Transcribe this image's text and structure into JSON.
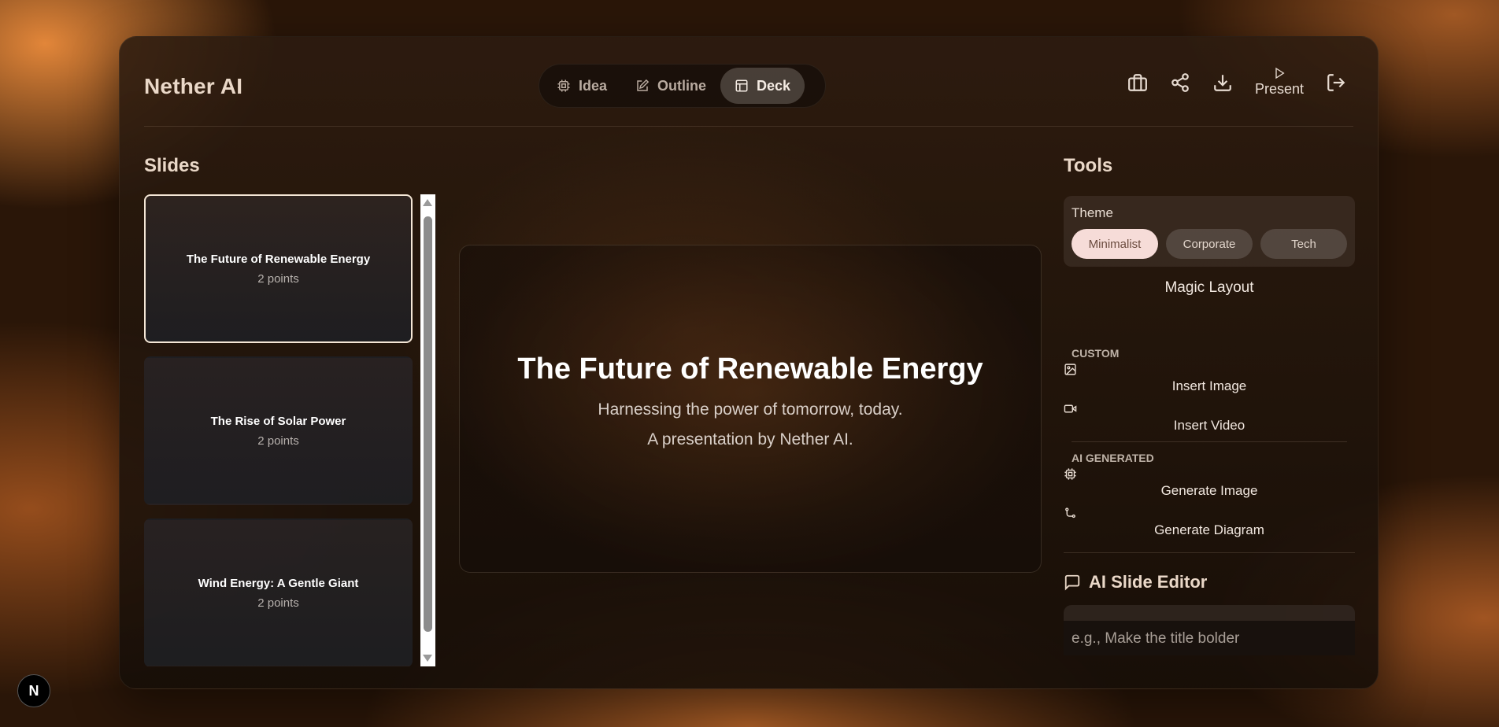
{
  "app": {
    "brand": "Nether AI"
  },
  "nav": {
    "tabs": [
      {
        "label": "Idea",
        "icon": "cpu-icon",
        "active": false
      },
      {
        "label": "Outline",
        "icon": "edit-icon",
        "active": false
      },
      {
        "label": "Deck",
        "icon": "layout-icon",
        "active": true
      }
    ]
  },
  "actions": {
    "present_label": "Present",
    "icons": [
      "briefcase-icon",
      "share-icon",
      "download-icon",
      "play-icon",
      "logout-icon"
    ]
  },
  "slides": {
    "heading": "Slides",
    "items": [
      {
        "title": "The Future of Renewable Energy",
        "subtitle": "2 points",
        "active": true
      },
      {
        "title": "The Rise of Solar Power",
        "subtitle": "2 points",
        "active": false
      },
      {
        "title": "Wind Energy: A Gentle Giant",
        "subtitle": "2 points",
        "active": false
      }
    ]
  },
  "canvas": {
    "title": "The Future of Renewable Energy",
    "subtitle": "Harnessing the power of tomorrow, today.",
    "byline": "A presentation by Nether AI."
  },
  "tools": {
    "heading": "Tools",
    "theme_label": "Theme",
    "themes": [
      "Minimalist",
      "Corporate",
      "Tech"
    ],
    "active_theme": "Minimalist",
    "magic_layout": "Magic Layout",
    "custom_label": "CUSTOM",
    "insert_image": "Insert Image",
    "insert_video": "Insert Video",
    "ai_label": "AI GENERATED",
    "generate_image": "Generate Image",
    "generate_diagram": "Generate Diagram"
  },
  "editor": {
    "heading": "AI Slide Editor",
    "placeholder": "e.g., Make the title bolder"
  },
  "badge": {
    "letter": "N"
  },
  "colors": {
    "accent": "#f6dcd8",
    "active_border": "#f4e6d6",
    "panel_bg": "#22160c"
  }
}
